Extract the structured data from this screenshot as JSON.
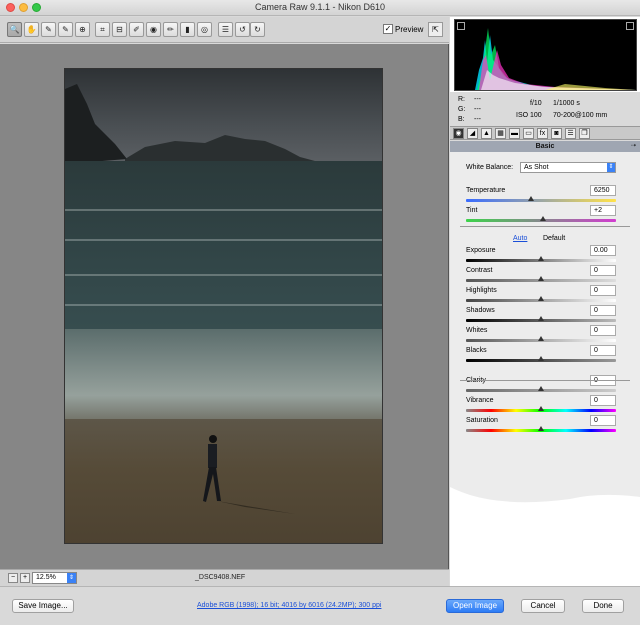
{
  "window": {
    "title": "Camera Raw 9.1.1  -  Nikon D610"
  },
  "toolbar": {
    "preview_label": "Preview",
    "preview_checked": "✓"
  },
  "tools": [
    {
      "name": "zoom-tool",
      "glyph": "🔍"
    },
    {
      "name": "hand-tool",
      "glyph": "✋"
    },
    {
      "name": "white-balance-tool",
      "glyph": "✎"
    },
    {
      "name": "color-sampler-tool",
      "glyph": "✎"
    },
    {
      "name": "targeted-adjustment-tool",
      "glyph": "⊕"
    },
    {
      "name": "crop-tool",
      "glyph": "⌗"
    },
    {
      "name": "straighten-tool",
      "glyph": "⊟"
    },
    {
      "name": "spot-removal-tool",
      "glyph": "✐"
    },
    {
      "name": "red-eye-tool",
      "glyph": "◉"
    },
    {
      "name": "adjustment-brush-tool",
      "glyph": "✏"
    },
    {
      "name": "graduated-filter-tool",
      "glyph": "▮"
    },
    {
      "name": "radial-filter-tool",
      "glyph": "◎"
    },
    {
      "name": "preferences-tool",
      "glyph": "☰"
    },
    {
      "name": "rotate-left-tool",
      "glyph": "↺"
    },
    {
      "name": "rotate-right-tool",
      "glyph": "↻"
    }
  ],
  "status": {
    "zoom": "12.5%",
    "filename": "_DSC9408.NEF"
  },
  "meta": {
    "r_label": "R:",
    "g_label": "G:",
    "b_label": "B:",
    "r": "---",
    "g": "---",
    "b": "---",
    "aperture": "f/10",
    "shutter": "1/1000 s",
    "iso": "ISO 100",
    "lens": "70-200@100 mm"
  },
  "panel": {
    "section_title": "Basic",
    "wb_label": "White Balance:",
    "wb_value": "As Shot",
    "auto": "Auto",
    "default": "Default",
    "sliders": [
      {
        "label": "Temperature",
        "value": "6250",
        "pos": 0.43
      },
      {
        "label": "Tint",
        "value": "+2",
        "pos": 0.51
      },
      {
        "label": "Exposure",
        "value": "0.00",
        "pos": 0.5
      },
      {
        "label": "Contrast",
        "value": "0",
        "pos": 0.5
      },
      {
        "label": "Highlights",
        "value": "0",
        "pos": 0.5
      },
      {
        "label": "Shadows",
        "value": "0",
        "pos": 0.5
      },
      {
        "label": "Whites",
        "value": "0",
        "pos": 0.5
      },
      {
        "label": "Blacks",
        "value": "0",
        "pos": 0.5
      },
      {
        "label": "Clarity",
        "value": "0",
        "pos": 0.5
      },
      {
        "label": "Vibrance",
        "value": "0",
        "pos": 0.5
      },
      {
        "label": "Saturation",
        "value": "0",
        "pos": 0.5
      }
    ]
  },
  "footer": {
    "save": "Save Image...",
    "workflow": "Adobe RGB (1998); 16 bit; 4016 by 6016 (24.2MP); 300 ppi",
    "open": "Open Image",
    "cancel": "Cancel",
    "done": "Done"
  },
  "colors": {
    "accent": "#2d7cf6",
    "canvas": "#868686",
    "photo_frame": "#333333"
  }
}
